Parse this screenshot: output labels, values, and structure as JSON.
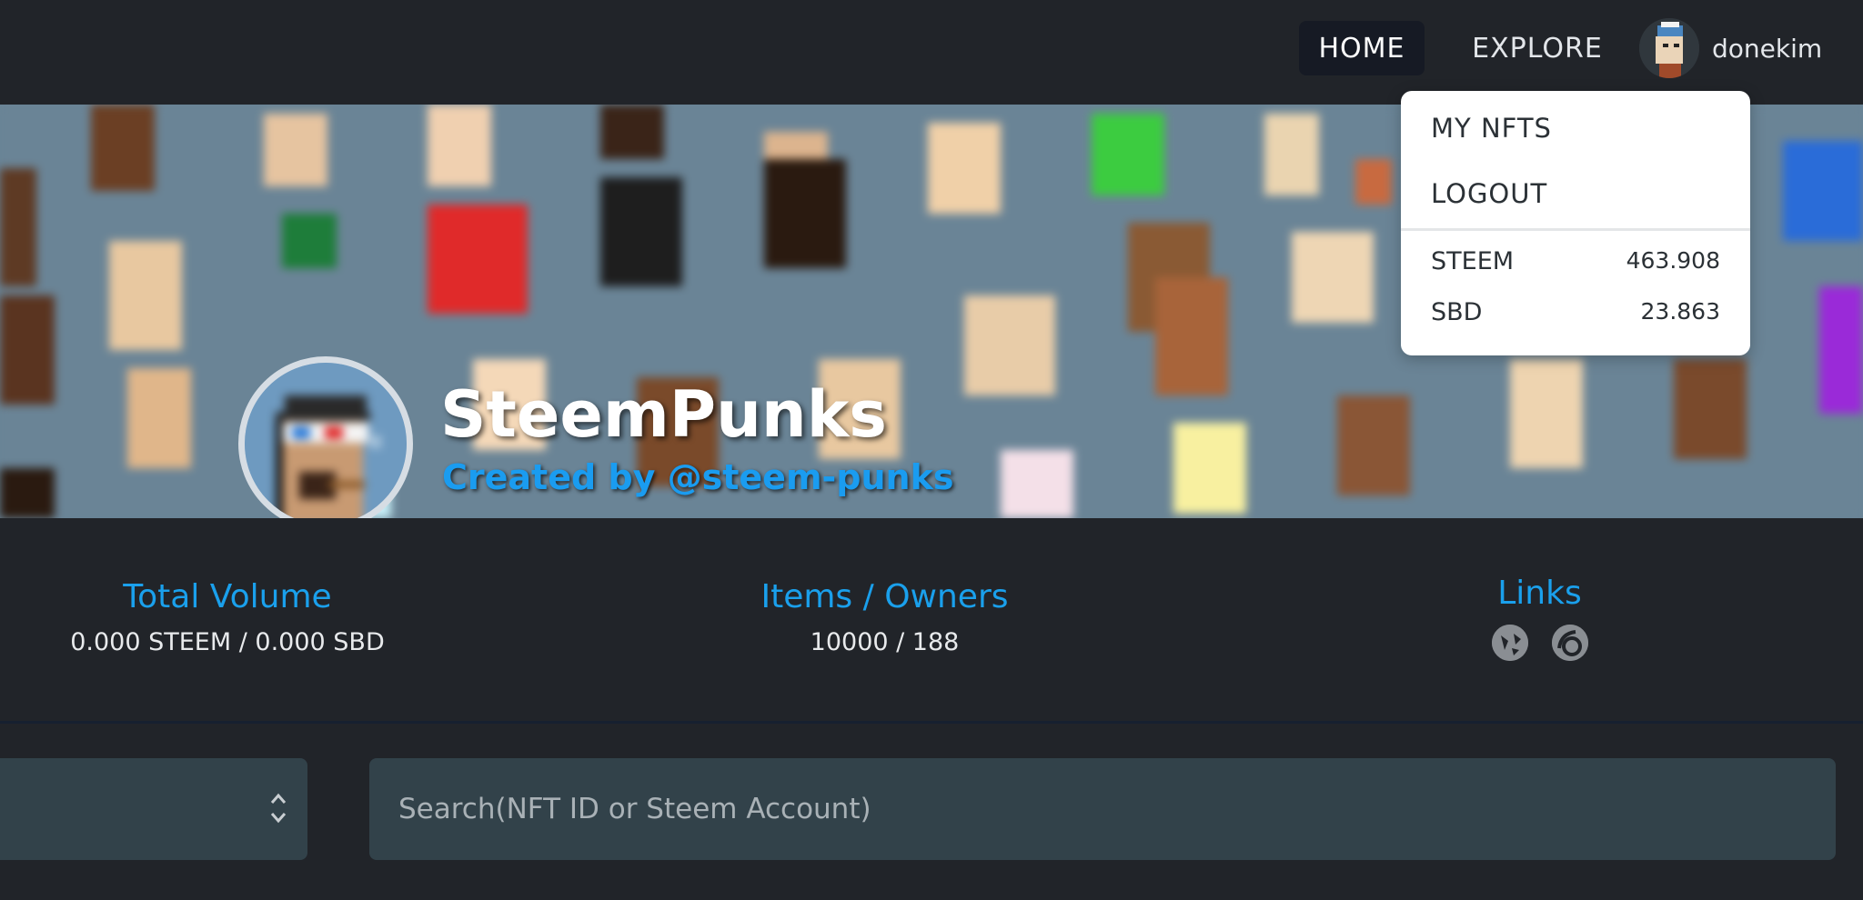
{
  "nav": {
    "home_label": "HOME",
    "explore_label": "EXPLORE",
    "username": "donekim"
  },
  "dropdown": {
    "my_nfts_label": "MY NFTS",
    "logout_label": "LOGOUT",
    "balances": [
      {
        "currency": "STEEM",
        "amount": "463.908"
      },
      {
        "currency": "SBD",
        "amount": "23.863"
      }
    ]
  },
  "collection": {
    "title": "SteemPunks",
    "creator": "Created by @steem-punks"
  },
  "stats": {
    "volume_title": "Total Volume",
    "volume_value": "0.000 STEEM /  0.000 SBD",
    "items_title": "Items / Owners",
    "items_value": "10000 /  188",
    "links_title": "Links",
    "link_icons": [
      "globe-icon",
      "discord-icon"
    ]
  },
  "filters": {
    "search_placeholder": "Search(NFT ID or Steem Account)"
  },
  "colors": {
    "accent": "#1aa0ec",
    "background": "#212429",
    "input_bg": "#32424a",
    "banner_bg": "#6a8496"
  }
}
